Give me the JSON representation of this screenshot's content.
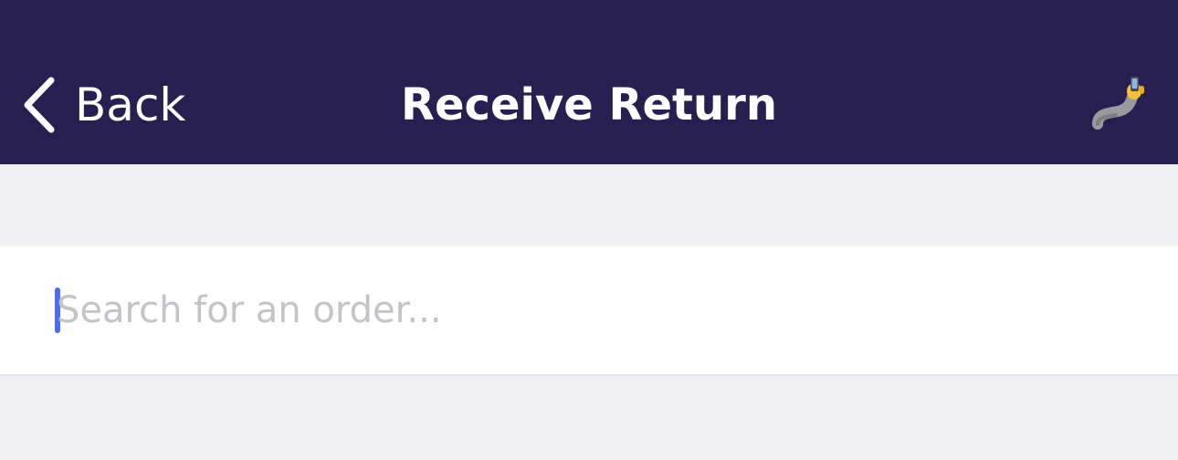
{
  "nav": {
    "back_label": "Back",
    "back_icon": "chevron-left-icon",
    "title": "Receive Return",
    "action_icon": "selfie-icon"
  },
  "search": {
    "placeholder": "Search for an order...",
    "value": ""
  },
  "colors": {
    "nav_background": "#261f4f",
    "page_background": "#f1f1f3",
    "caret": "#4a6ef0",
    "placeholder": "#c4c4c8"
  }
}
